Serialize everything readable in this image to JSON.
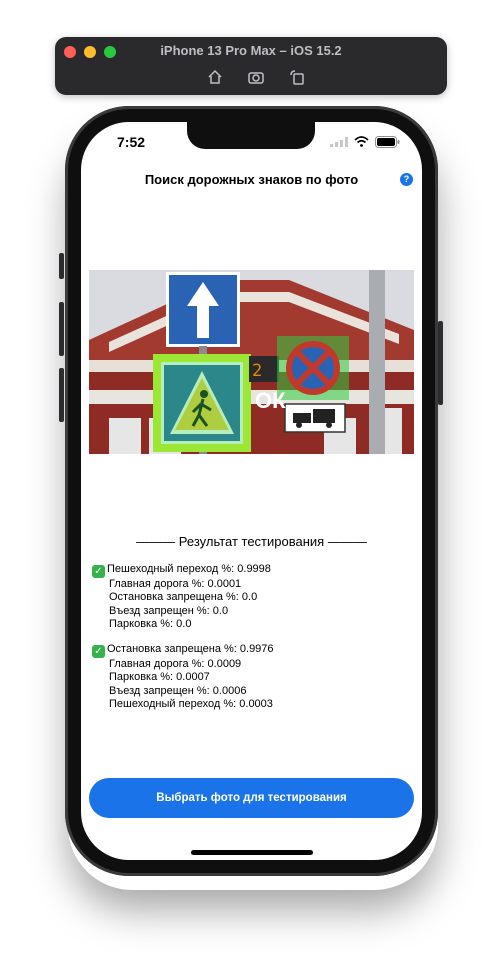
{
  "simulator": {
    "title": "iPhone 13 Pro Max – iOS 15.2",
    "toolbar": [
      "home-icon",
      "screenshot-icon",
      "rotate-icon"
    ]
  },
  "status_bar": {
    "time": "7:52",
    "icons": [
      "signal-icon",
      "wifi-icon",
      "battery-icon"
    ]
  },
  "nav": {
    "title": "Поиск дорожных знаков по фото",
    "help": "?"
  },
  "photo": {
    "description_icons": [
      "main-road-sign",
      "pedestrian-crossing-sign",
      "no-stopping-sign",
      "tow-truck-plate"
    ]
  },
  "results": {
    "title": "——— Результат тестирования ———",
    "blocks": [
      {
        "top": "Пешеходный переход %: 0.9998",
        "lines": [
          "Главная дорога %: 0.0001",
          "Остановка запрещена %: 0.0",
          "Въезд запрещен %: 0.0",
          "Парковка %: 0.0"
        ]
      },
      {
        "top": "Остановка запрещена %: 0.9976",
        "lines": [
          "Главная дорога %: 0.0009",
          "Парковка %: 0.0007",
          "Въезд запрещен %: 0.0006",
          "Пешеходный переход %: 0.0003"
        ]
      }
    ]
  },
  "button": {
    "label": "Выбрать фото для тестирования"
  },
  "colors": {
    "accent": "#1a73e8",
    "check": "#35b34a",
    "detection": "#2ecc40"
  }
}
